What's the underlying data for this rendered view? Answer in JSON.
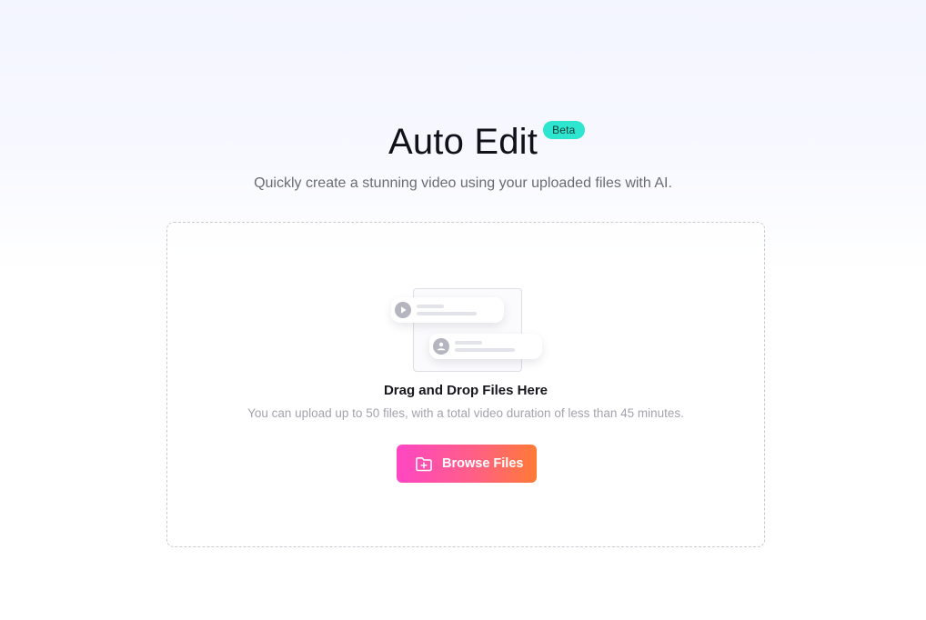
{
  "header": {
    "title": "Auto Edit",
    "badge": "Beta",
    "subtitle": "Quickly create a stunning video using your uploaded files with AI."
  },
  "dropzone": {
    "heading": "Drag and Drop Files Here",
    "hint": "You can upload up to 50 files, with a total video duration of less than 45 minutes.",
    "browse_label": "Browse Files",
    "illustration_icons": [
      "play-icon",
      "image-icon"
    ]
  },
  "colors": {
    "badge_bg": "#2ee6cf",
    "button_gradient_start": "#ff46c4",
    "button_gradient_end": "#ff7a36",
    "dropzone_border": "#c9c9d1"
  }
}
